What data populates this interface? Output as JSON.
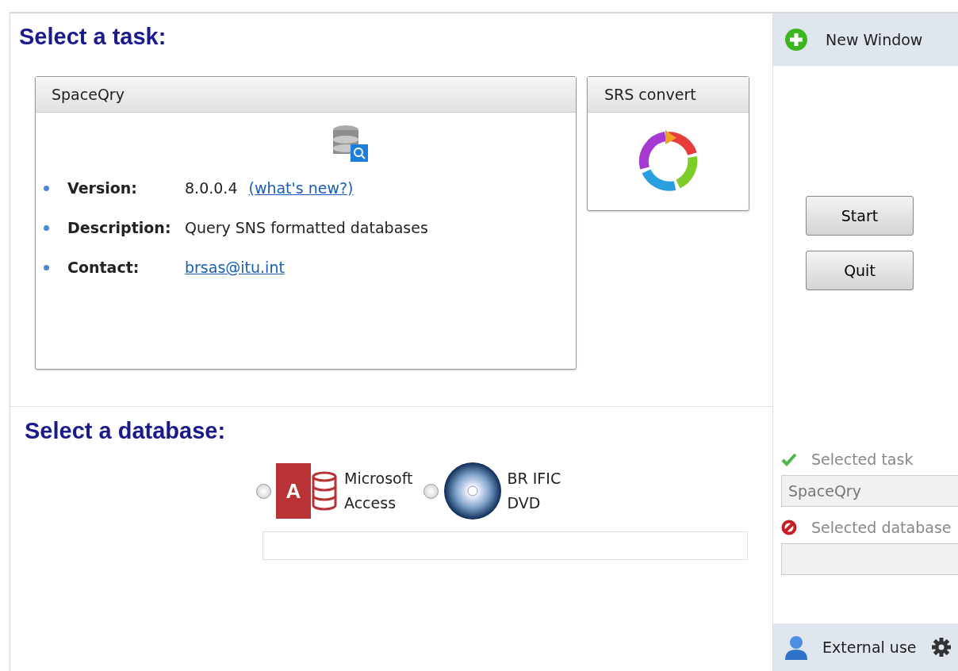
{
  "task_section": {
    "title": "Select a task:",
    "tasks": [
      {
        "kind": "details",
        "name": "SpaceQry",
        "fields": [
          {
            "label": "Version:",
            "value": "8.0.0.4",
            "link": "(what's new?)"
          },
          {
            "label": "Description:",
            "value": "Query SNS formatted databases"
          },
          {
            "label": "Contact:",
            "link": "brsas@itu.int"
          }
        ]
      },
      {
        "kind": "icon",
        "name": "SRS convert"
      }
    ]
  },
  "database_section": {
    "title": "Select a database:",
    "databases": [
      {
        "name_lines": [
          "Microsoft",
          "Access"
        ],
        "kind": "access",
        "icon_letter": "A",
        "checked": false
      },
      {
        "name_lines": [
          "BR IFIC",
          "DVD"
        ],
        "kind": "dvd",
        "checked": false
      }
    ]
  },
  "sidebar": {
    "new_window": "New Window",
    "buttons": [
      "Start",
      "Quit"
    ],
    "status": [
      {
        "label": "Selected task",
        "done": true,
        "value": "SpaceQry"
      },
      {
        "label": "Selected database",
        "done": false
      }
    ],
    "footer": "External use"
  }
}
